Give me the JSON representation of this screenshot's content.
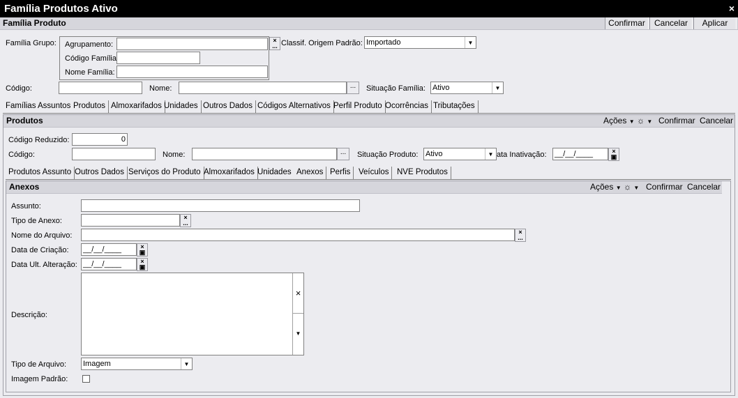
{
  "window": {
    "title": "Família Produtos Ativo",
    "close_glyph": "×"
  },
  "familia": {
    "header": "Família Produto",
    "buttons": {
      "confirmar": "Confirmar",
      "cancelar": "Cancelar",
      "aplicar": "Aplicar"
    },
    "grupo_label": "Família Grupo:",
    "agrupamento_label": "Agrupamento:",
    "agrupamento_value": "",
    "codigo_familia_label": "Código Família:",
    "codigo_familia_value": "",
    "nome_familia_label": "Nome Família:",
    "nome_familia_value": "",
    "classif_label": "Classif. Origem Padrão:",
    "classif_value": "Importado",
    "codigo_label": "Código:",
    "codigo_value": "",
    "nome_label": "Nome:",
    "nome_value": "",
    "situacao_label": "Situação Família:",
    "situacao_value": "Ativo",
    "tabs": [
      "Famílias Assuntos",
      "Produtos",
      "Almoxarifados",
      "Unidades",
      "Outros Dados",
      "Códigos Alternativos",
      "Perfil Produto",
      "Ocorrências",
      "Tributações"
    ],
    "active_tab": "Produtos"
  },
  "produtos": {
    "header": "Produtos",
    "acoes_label": "Ações",
    "confirmar": "Confirmar",
    "cancelar": "Cancelar",
    "codigo_reduzido_label": "Código Reduzido:",
    "codigo_reduzido_value": "0",
    "codigo_label": "Código:",
    "codigo_value": "",
    "nome_label": "Nome:",
    "nome_value": "",
    "situacao_label": "Situação Produto:",
    "situacao_value": "Ativo",
    "data_inativacao_label": "ata Inativação:",
    "data_inativacao_value": "__/__/____",
    "tabs": [
      "Produtos Assunto",
      "Outros Dados",
      "Serviços do Produto",
      "Almoxarifados",
      "Unidades",
      "Anexos",
      "Perfis",
      "Veículos",
      "NVE Produtos"
    ],
    "active_tab": "Anexos"
  },
  "anexos": {
    "header": "Anexos",
    "acoes_label": "Ações",
    "confirmar": "Confirmar",
    "cancelar": "Cancelar",
    "assunto_label": "Assunto:",
    "assunto_value": "",
    "tipo_anexo_label": "Tipo de Anexo:",
    "tipo_anexo_value": "",
    "nome_arquivo_label": "Nome do Arquivo:",
    "nome_arquivo_value": "",
    "data_criacao_label": "Data de Criação:",
    "data_criacao_value": "__/__/____",
    "data_alteracao_label": "Data Ult. Alteração:",
    "data_alteracao_value": "__/__/____",
    "descricao_label": "Descrição:",
    "descricao_value": "",
    "tipo_arquivo_label": "Tipo de Arquivo:",
    "tipo_arquivo_value": "Imagem",
    "imagem_padrao_label": "Imagem Padrão:",
    "imagem_padrao_checked": false
  },
  "glyphs": {
    "dots": "...",
    "clear": "×",
    "dropdown": "▼",
    "acoes_caret": "▼",
    "settings": "☼"
  }
}
